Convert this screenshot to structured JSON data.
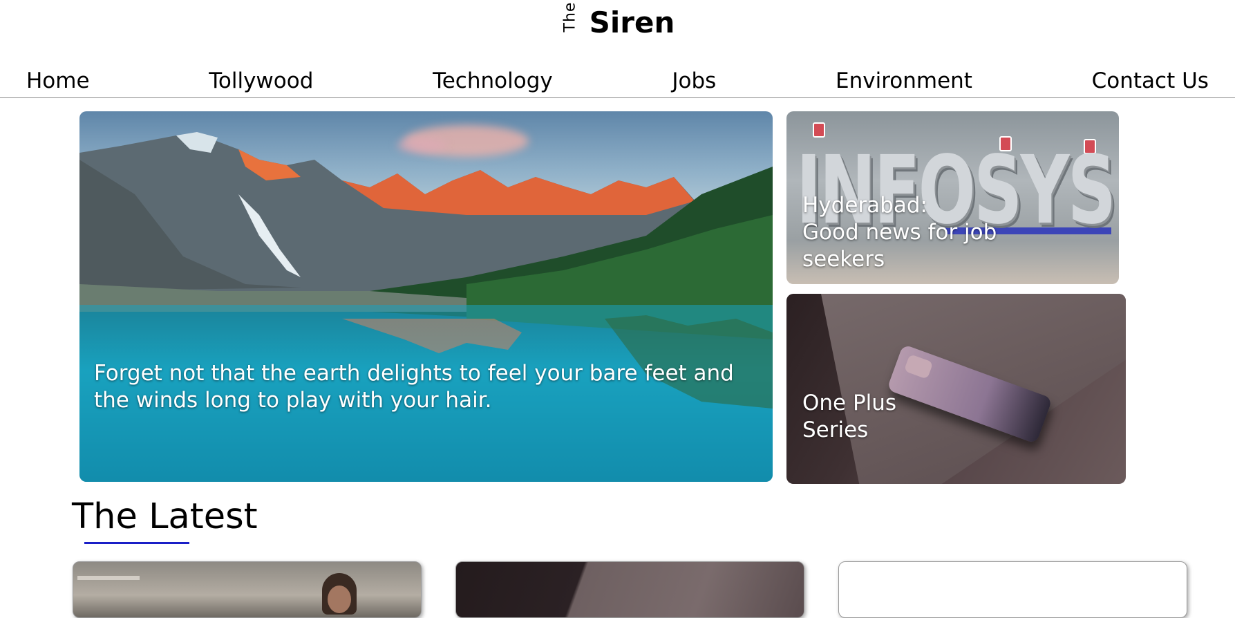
{
  "brand": {
    "prefix": "The",
    "name": "Siren"
  },
  "nav": {
    "items": [
      {
        "label": "Home"
      },
      {
        "label": "Tollywood"
      },
      {
        "label": "Technology"
      },
      {
        "label": "Jobs"
      },
      {
        "label": "Environment"
      },
      {
        "label": "Contact Us"
      }
    ]
  },
  "featured": {
    "main": {
      "caption": "Forget not that the earth delights to feel your bare feet and the winds long to play with your hair.",
      "image": "mountain-lake-image"
    },
    "side": [
      {
        "caption_lines": [
          "Hyderabad:",
          "Good news for job",
          "seekers"
        ],
        "image": "infosys-sign-image",
        "image_text": "INFOSYS"
      },
      {
        "caption_lines": [
          "One Plus",
          "Series"
        ],
        "image": "oneplus-phone-image"
      }
    ]
  },
  "latest": {
    "title": "The Latest",
    "accent_color": "#1a1fc7",
    "cards": [
      {
        "image": "movie-poster-image"
      },
      {
        "image": "phone-shelf-image"
      },
      {
        "image": "blank-card-image"
      }
    ]
  }
}
